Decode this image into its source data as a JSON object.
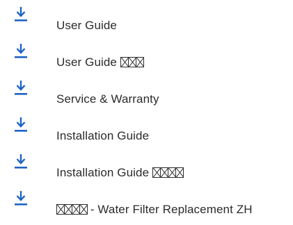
{
  "colors": {
    "icon": "#1e63c4",
    "text": "#2b2b2b",
    "background": "#ffffff"
  },
  "downloads": [
    {
      "label": "User Guide",
      "suffix_glyph_count": 0,
      "prefix_glyph_count": 0,
      "icon": "download-icon"
    },
    {
      "label": "User Guide ",
      "suffix_glyph_count": 3,
      "prefix_glyph_count": 0,
      "icon": "download-icon"
    },
    {
      "label": "Service & Warranty",
      "suffix_glyph_count": 0,
      "prefix_glyph_count": 0,
      "icon": "download-icon"
    },
    {
      "label": "Installation Guide",
      "suffix_glyph_count": 0,
      "prefix_glyph_count": 0,
      "icon": "download-icon"
    },
    {
      "label": "Installation Guide ",
      "suffix_glyph_count": 4,
      "prefix_glyph_count": 0,
      "icon": "download-icon"
    },
    {
      "label": " - Water Filter Replacement ZH",
      "suffix_glyph_count": 0,
      "prefix_glyph_count": 4,
      "icon": "download-icon"
    }
  ]
}
